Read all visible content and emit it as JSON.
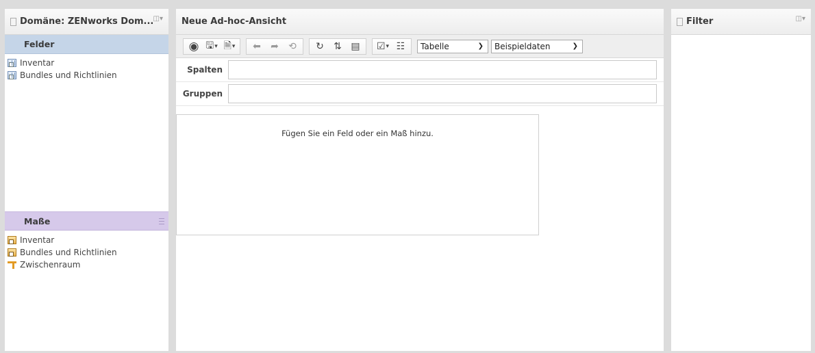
{
  "left_panel": {
    "title": "Domäne: ZENworks Dom...",
    "felder": {
      "label": "Felder",
      "items": [
        {
          "label": "Inventar",
          "icon": "table-blue-icon"
        },
        {
          "label": "Bundles und Richtlinien",
          "icon": "table-blue-icon"
        }
      ]
    },
    "masse": {
      "label": "Maße",
      "items": [
        {
          "label": "Inventar",
          "icon": "table-gold-icon"
        },
        {
          "label": "Bundles und Richtlinien",
          "icon": "table-gold-icon"
        },
        {
          "label": "Zwischenraum",
          "icon": "ruler-icon"
        }
      ]
    }
  },
  "center_panel": {
    "title": "Neue Ad-hoc-Ansicht",
    "toolbar": {
      "view_type": {
        "selected": "Tabelle"
      },
      "data_mode": {
        "selected": "Beispieldaten"
      }
    },
    "rows": {
      "columns_label": "Spalten",
      "groups_label": "Gruppen"
    },
    "canvas_message": "Fügen Sie ein Feld oder ein Maß hinzu."
  },
  "right_panel": {
    "title": "Filter"
  },
  "colors": {
    "felder_header": "#c5d5e8",
    "masse_header": "#d6c9ea",
    "background": "#dcdcdc"
  }
}
